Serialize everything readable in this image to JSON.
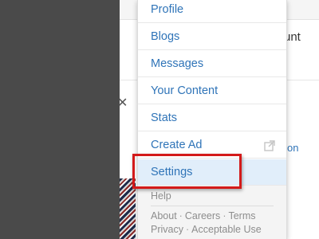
{
  "page": {
    "partial_header_text": "unt",
    "close_glyph": "✕",
    "partial_link_text": "on"
  },
  "menu": {
    "items": [
      {
        "label": "Profile"
      },
      {
        "label": "Blogs"
      },
      {
        "label": "Messages"
      },
      {
        "label": "Your Content"
      },
      {
        "label": "Stats"
      },
      {
        "label": "Create Ad",
        "icon": "external-link-icon"
      },
      {
        "label": "Settings",
        "selected": true
      }
    ],
    "footer": {
      "help": "Help",
      "links_row1": [
        "About",
        "Careers",
        "Terms"
      ],
      "links_row2": [
        "Privacy",
        "Acceptable Use"
      ]
    }
  },
  "colors": {
    "link": "#2f74b8",
    "selected_bg": "#e1eefa",
    "highlight": "#d31a1a",
    "overlay": "#4a4a4a"
  }
}
